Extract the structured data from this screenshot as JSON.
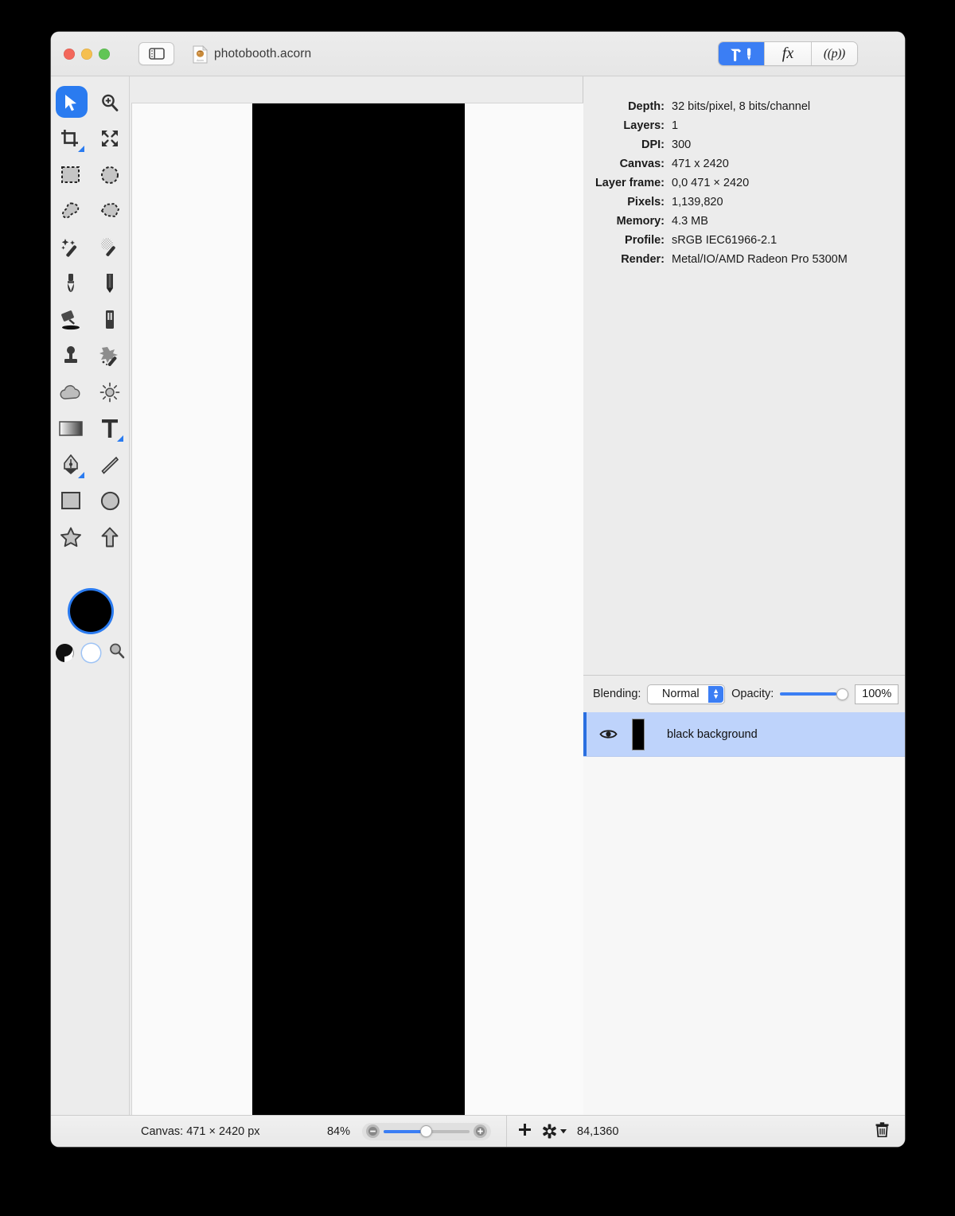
{
  "window": {
    "title": "photobooth.acorn",
    "traffic_lights": [
      "close",
      "minimize",
      "zoom"
    ],
    "sidebar_toggle_icon": "sidebar-toggle-icon",
    "document_icon": "acorn-document-icon"
  },
  "inspector_tabs": [
    {
      "id": "tools",
      "icon": "hammer-screwdriver-icon",
      "label": "",
      "selected": true
    },
    {
      "id": "filters",
      "icon": "fx-icon",
      "label": "fx",
      "selected": false
    },
    {
      "id": "presets",
      "icon": "palette-icon",
      "label": "((p))",
      "selected": false
    }
  ],
  "tools": [
    {
      "name": "move-tool",
      "icon": "arrow-cursor-icon",
      "selected": true,
      "badge": false
    },
    {
      "name": "zoom-tool",
      "icon": "magnifier-plus-icon",
      "selected": false,
      "badge": false
    },
    {
      "name": "crop-tool",
      "icon": "crop-icon",
      "selected": false,
      "badge": true
    },
    {
      "name": "transform-tool",
      "icon": "four-arrows-icon",
      "selected": false,
      "badge": false
    },
    {
      "name": "rectangular-selection-tool",
      "icon": "dashed-rectangle-icon",
      "selected": false,
      "badge": false
    },
    {
      "name": "elliptical-selection-tool",
      "icon": "dashed-ellipse-icon",
      "selected": false,
      "badge": false
    },
    {
      "name": "lasso-selection-tool",
      "icon": "lasso-icon",
      "selected": false,
      "badge": false
    },
    {
      "name": "polygonal-lasso-tool",
      "icon": "polygon-lasso-icon",
      "selected": false,
      "badge": false
    },
    {
      "name": "magic-wand-tool",
      "icon": "magic-wand-icon",
      "selected": false,
      "badge": false
    },
    {
      "name": "instant-alpha-tool",
      "icon": "instant-alpha-icon",
      "selected": false,
      "badge": false
    },
    {
      "name": "brush-tool",
      "icon": "paintbrush-icon",
      "selected": false,
      "badge": false
    },
    {
      "name": "pencil-tool",
      "icon": "pencil-icon",
      "selected": false,
      "badge": false
    },
    {
      "name": "paint-bucket-tool",
      "icon": "paint-bucket-icon",
      "selected": false,
      "badge": false
    },
    {
      "name": "eraser-tool",
      "icon": "eraser-icon",
      "selected": false,
      "badge": false
    },
    {
      "name": "clone-stamp-tool",
      "icon": "clone-stamp-icon",
      "selected": false,
      "badge": false
    },
    {
      "name": "smudge-tool",
      "icon": "smudge-splatter-icon",
      "selected": false,
      "badge": false
    },
    {
      "name": "blur-tool",
      "icon": "cloud-icon",
      "selected": false,
      "badge": false
    },
    {
      "name": "dodge-tool",
      "icon": "sun-icon",
      "selected": false,
      "badge": false
    },
    {
      "name": "gradient-tool",
      "icon": "gradient-icon",
      "selected": false,
      "badge": false
    },
    {
      "name": "text-tool",
      "icon": "text-t-icon",
      "selected": false,
      "badge": true
    },
    {
      "name": "bezier-pen-tool",
      "icon": "pen-nib-icon",
      "selected": false,
      "badge": true
    },
    {
      "name": "line-tool",
      "icon": "line-icon",
      "selected": false,
      "badge": false
    },
    {
      "name": "rectangle-shape-tool",
      "icon": "square-icon",
      "selected": false,
      "badge": false
    },
    {
      "name": "ellipse-shape-tool",
      "icon": "circle-icon",
      "selected": false,
      "badge": false
    },
    {
      "name": "star-shape-tool",
      "icon": "star-icon",
      "selected": false,
      "badge": false
    },
    {
      "name": "arrow-shape-tool",
      "icon": "arrow-up-icon",
      "selected": false,
      "badge": false
    }
  ],
  "color_swatches": {
    "foreground_color": "#000000",
    "background_color": "#ffffff",
    "swap_icon": "black-white-circle-icon",
    "picker_icon": "magnifier-loupe-icon"
  },
  "info": {
    "rows": [
      {
        "label": "Depth:",
        "value": "32 bits/pixel, 8 bits/channel"
      },
      {
        "label": "Layers:",
        "value": "1"
      },
      {
        "label": "DPI:",
        "value": "300"
      },
      {
        "label": "Canvas:",
        "value": "471 x 2420"
      },
      {
        "label": "Layer frame:",
        "value": "0,0 471 × 2420"
      },
      {
        "label": "Pixels:",
        "value": "1,139,820"
      },
      {
        "label": "Memory:",
        "value": "4.3 MB"
      },
      {
        "label": "Profile:",
        "value": "sRGB IEC61966-2.1"
      },
      {
        "label": "Render:",
        "value": "Metal/IO/AMD Radeon Pro 5300M"
      }
    ]
  },
  "layers_panel": {
    "blending_label": "Blending:",
    "blending_value": "Normal",
    "blending_options": [
      "Normal"
    ],
    "opacity_label": "Opacity:",
    "opacity_value": "100%",
    "opacity_percent": 100,
    "layers": [
      {
        "name": "black background",
        "visible": true,
        "selected": true,
        "thumbnail_color": "#000000",
        "eye_icon": "eye-icon"
      }
    ]
  },
  "status_bar": {
    "canvas_text": "Canvas: 471 × 2420 px",
    "zoom_percent": "84%",
    "zoom_out_icon": "zoom-out-icon",
    "zoom_in_icon": "zoom-in-icon",
    "add_layer_icon": "plus-icon",
    "layer_actions_icon": "gear-icon",
    "coordinates": "84,1360",
    "delete_icon": "trash-icon"
  },
  "canvas": {
    "background_color": "#fafafa",
    "shape_color": "#000000"
  },
  "colors": {
    "accent": "#2a7bf4",
    "selection_row": "#bed3fb",
    "window_chrome": "#ececec"
  }
}
